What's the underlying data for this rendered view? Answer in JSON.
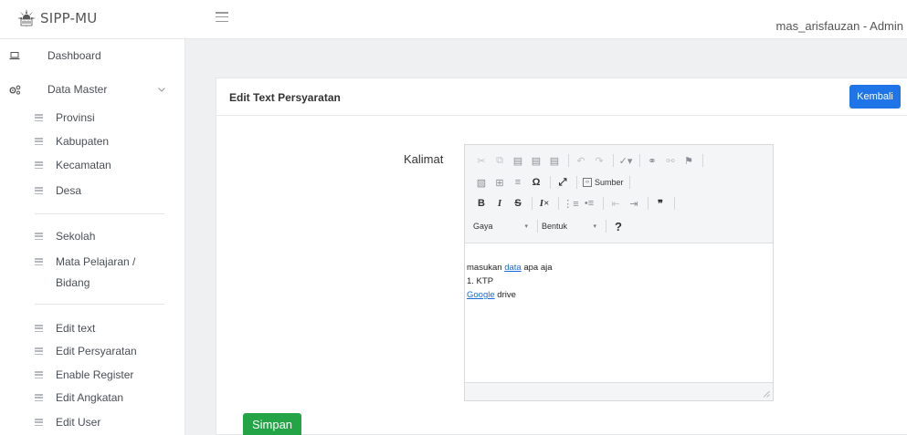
{
  "app": {
    "name": "SIPP-MU"
  },
  "header": {
    "user": "mas_arisfauzan - Admin"
  },
  "sidebar": {
    "dashboard": "Dashboard",
    "data_master": "Data Master",
    "group1": [
      "Provinsi",
      "Kabupaten",
      "Kecamatan",
      "Desa"
    ],
    "group2": [
      "Sekolah",
      "Mata Pelajaran /",
      "Bidang"
    ],
    "group3": [
      "Edit text",
      "Edit Persyaratan",
      "Enable Register",
      "Edit Angkatan",
      "Edit User"
    ]
  },
  "card": {
    "title": "Edit Text Persyaratan",
    "back_label": "Kembali",
    "field_label": "Kalimat",
    "save_label": "Simpan"
  },
  "editor": {
    "source_label": "Sumber",
    "style_label": "Gaya",
    "format_label": "Bentuk",
    "help_label": "?",
    "content": {
      "line1_prefix": "masukan ",
      "line1_link": "data",
      "line1_suffix": " apa aja",
      "line2": "1. KTP",
      "line3_link": "Google",
      "line3_suffix": " drive"
    }
  },
  "colors": {
    "primary": "#1f74e8",
    "success": "#22a447"
  }
}
